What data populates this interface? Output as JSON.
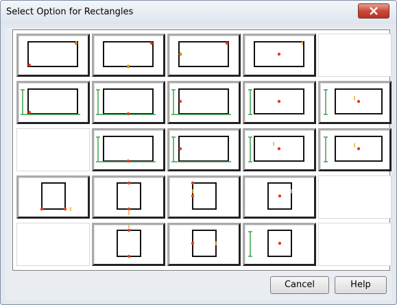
{
  "window": {
    "title": "Select Option for Rectangles"
  },
  "buttons": {
    "cancel": "Cancel",
    "help": "Help"
  },
  "options": [
    {
      "name": "option-r1c1",
      "empty": false
    },
    {
      "name": "option-r1c2",
      "empty": false
    },
    {
      "name": "option-r1c3",
      "empty": false
    },
    {
      "name": "option-r1c4",
      "empty": false
    },
    {
      "name": "option-r1c5",
      "empty": true
    },
    {
      "name": "option-r2c1",
      "empty": false
    },
    {
      "name": "option-r2c2",
      "empty": false
    },
    {
      "name": "option-r2c3",
      "empty": false
    },
    {
      "name": "option-r2c4",
      "empty": false
    },
    {
      "name": "option-r2c5",
      "empty": false
    },
    {
      "name": "option-r3c1",
      "empty": true
    },
    {
      "name": "option-r3c2",
      "empty": false
    },
    {
      "name": "option-r3c3",
      "empty": false
    },
    {
      "name": "option-r3c4",
      "empty": false
    },
    {
      "name": "option-r3c5",
      "empty": false
    },
    {
      "name": "option-r4c1",
      "empty": false
    },
    {
      "name": "option-r4c2",
      "empty": false
    },
    {
      "name": "option-r4c3",
      "empty": false
    },
    {
      "name": "option-r4c4",
      "empty": false
    },
    {
      "name": "option-r4c5",
      "empty": true
    },
    {
      "name": "option-r5c1",
      "empty": true
    },
    {
      "name": "option-r5c2",
      "empty": false
    },
    {
      "name": "option-r5c3",
      "empty": false
    },
    {
      "name": "option-r5c4",
      "empty": false
    },
    {
      "name": "option-r5c5",
      "empty": true
    }
  ]
}
